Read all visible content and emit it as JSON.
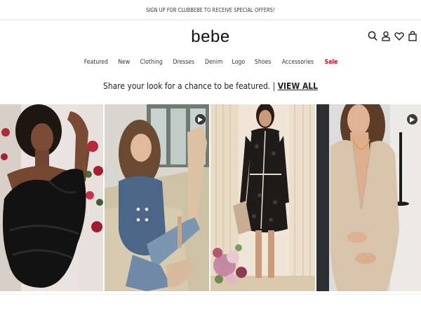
{
  "promo": {
    "text": "SIGN UP FOR CLUBBEBE TO RECEIVE SPECIAL OFFERS!"
  },
  "brand": {
    "logo": "bebe"
  },
  "header_icons": [
    "search-icon",
    "account-icon",
    "wishlist-heart-icon",
    "shopping-bag-icon"
  ],
  "nav": {
    "items": [
      {
        "label": "Featured"
      },
      {
        "label": "New"
      },
      {
        "label": "Clothing"
      },
      {
        "label": "Dresses"
      },
      {
        "label": "Denim"
      },
      {
        "label": "Logo"
      },
      {
        "label": "Shoes"
      },
      {
        "label": "Accessories"
      },
      {
        "label": "Sale"
      }
    ]
  },
  "feature": {
    "prompt": "Share your look for a chance to be featured. | ",
    "link": "VIEW ALL"
  },
  "gallery": {
    "tiles": [
      {
        "has_video": false
      },
      {
        "has_video": true
      },
      {
        "has_video": false
      },
      {
        "has_video": true
      }
    ]
  },
  "colors": {
    "sale": "#d0021b",
    "text": "#111111"
  }
}
